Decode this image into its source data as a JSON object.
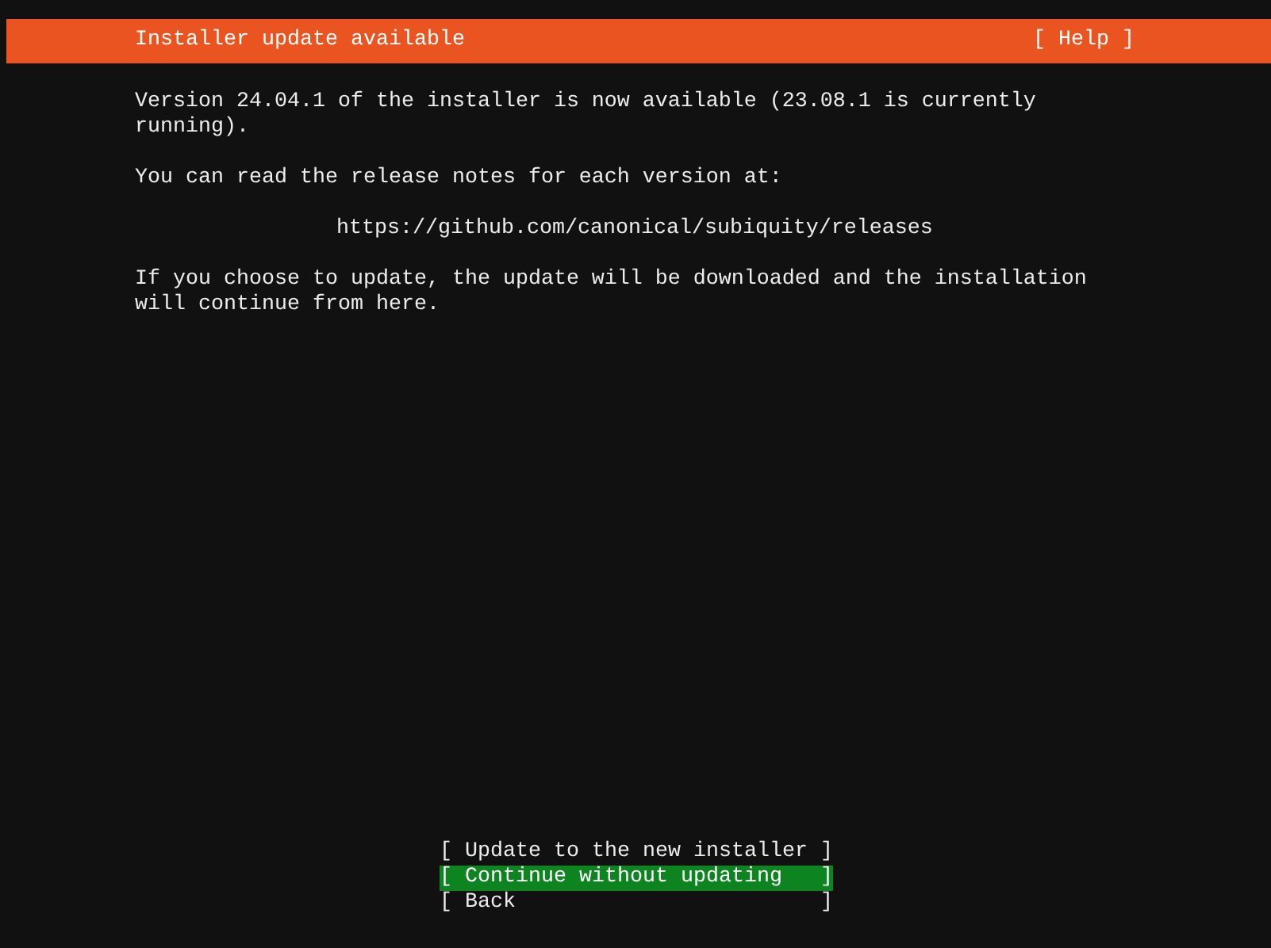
{
  "header": {
    "title": "Installer update available",
    "help": "[ Help ]"
  },
  "paragraphs": [
    {
      "kind": "text",
      "text": "Version 24.04.1 of the installer is now available (23.08.1 is currently running)."
    },
    {
      "kind": "text",
      "text": "You can read the release notes for each version at:"
    },
    {
      "kind": "link",
      "text": "https://github.com/canonical/subiquity/releases"
    },
    {
      "kind": "text",
      "text": "If you choose to update, the update will be downloaded and the installation will continue from here."
    }
  ],
  "buttons": [
    {
      "label": "[ Update to the new installer ]",
      "selected": false
    },
    {
      "label": "[ Continue without updating   ]",
      "selected": true
    },
    {
      "label": "[ Back                        ]",
      "selected": false
    }
  ]
}
